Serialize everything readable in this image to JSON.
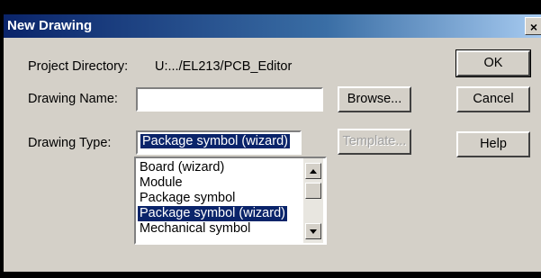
{
  "window": {
    "title": "New Drawing",
    "close_glyph": "×"
  },
  "project": {
    "label": "Project Directory:",
    "value": "U:.../EL213/PCB_Editor"
  },
  "drawing_name": {
    "label": "Drawing Name:",
    "value": ""
  },
  "drawing_type": {
    "label": "Drawing Type:",
    "selected": "Package symbol (wizard)",
    "options": [
      "Board (wizard)",
      "Module",
      "Package symbol",
      "Package symbol (wizard)",
      "Mechanical symbol"
    ],
    "selected_index": 3
  },
  "buttons": {
    "browse": "Browse...",
    "template": "Template...",
    "ok": "OK",
    "cancel": "Cancel",
    "help": "Help"
  }
}
